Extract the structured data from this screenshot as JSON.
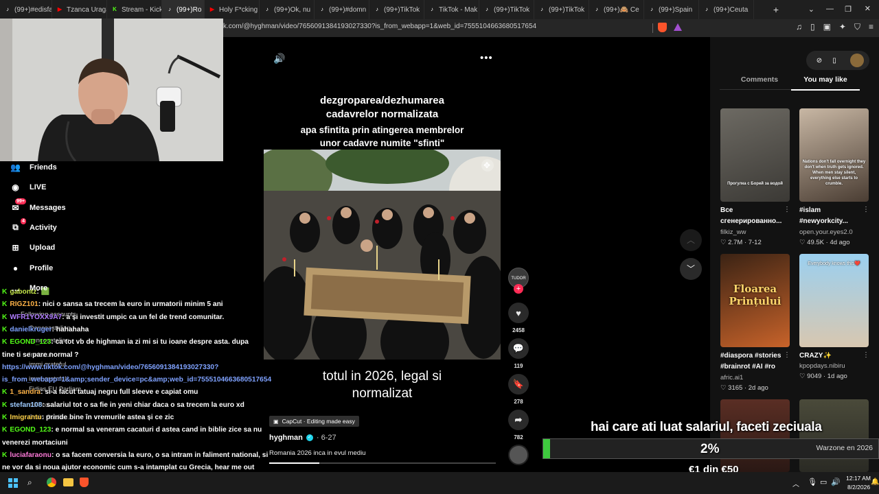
{
  "browser": {
    "tabs": [
      {
        "title": "(99+)#edisfar",
        "favicon": "tiktok",
        "color": "#ffffff"
      },
      {
        "title": "Tzanca Uraga",
        "favicon": "youtube",
        "color": "#ff0000"
      },
      {
        "title": "Stream - Kick",
        "favicon": "kick",
        "color": "#53fc18"
      },
      {
        "title": "(99+)Ro",
        "favicon": "tiktok",
        "color": "#ffffff",
        "active": true
      },
      {
        "title": "Holy F*cking",
        "favicon": "youtube",
        "color": "#ff0000"
      },
      {
        "title": "(99+)Ok, nu",
        "favicon": "tiktok",
        "color": "#ffffff"
      },
      {
        "title": "(99+)#domn",
        "favicon": "tiktok",
        "color": "#ffffff"
      },
      {
        "title": "(99+)TikTok",
        "favicon": "tiktok",
        "color": "#ffffff"
      },
      {
        "title": "TikTok - Mak",
        "favicon": "tiktok",
        "color": "#ffffff"
      },
      {
        "title": "(99+)TikTok",
        "favicon": "tiktok",
        "color": "#ffffff"
      },
      {
        "title": "(99+)TikTok",
        "favicon": "tiktok",
        "color": "#ffffff"
      },
      {
        "title": "(99+)🙈 Ce",
        "favicon": "tiktok",
        "color": "#ffffff"
      },
      {
        "title": "(99+)Spain",
        "favicon": "tiktok",
        "color": "#ffffff"
      },
      {
        "title": "(99+)Ceuta",
        "favicon": "tiktok",
        "color": "#ffffff"
      }
    ],
    "new_tab_label": "+",
    "url": "k.com/@hyghman/video/7656091384193027330?is_from_webapp=1&web_id=7555104663680517654"
  },
  "sidebar": {
    "items": [
      {
        "label": "Friends",
        "icon": "friends-icon"
      },
      {
        "label": "LIVE",
        "icon": "live-icon"
      },
      {
        "label": "Messages",
        "icon": "messages-icon",
        "badge": "99+"
      },
      {
        "label": "Activity",
        "icon": "activity-icon",
        "badge": "4"
      },
      {
        "label": "Upload",
        "icon": "upload-icon"
      },
      {
        "label": "Profile",
        "icon": "profile-icon"
      },
      {
        "label": "More",
        "icon": "more-icon"
      }
    ],
    "following_label": "Following accounts",
    "following": [
      "Oanceastelian",
      "oanceastelian",
      "Invitatul",
      "immi.grateful",
      "immi.grateful",
      "Fidias EU Parliam...",
      "stirivox",
      "Sorin Ovidiu..."
    ]
  },
  "chat": [
    {
      "user": "gabontz",
      "color": "#c6e84b",
      "text": ": 🟩"
    },
    {
      "user": "RIGZ101",
      "color": "#ffb347",
      "text": ": nici o sansa sa trecem la euro in urmatorii minim 5 ani"
    },
    {
      "user": "WFR1YOXX9A7",
      "color": "#b07cff",
      "text": ": a și investit umpic ca un fel de trend comunitar."
    },
    {
      "user": "danielkruger",
      "color": "#7fa2ff",
      "text": ": hahahaha"
    },
    {
      "user": "EGOND_123",
      "color": "#53fc18",
      "text": ": ca tot vb de highman ia zi mi si tu ioane despre asta. dupa"
    },
    {
      "user": "",
      "color": "#ffffff",
      "text": "tine ti se pare normal ?"
    },
    {
      "user": "",
      "color": "#7fa2ff",
      "text": "https://www.tiktok.com/@hyghman/video/7656091384193027330?"
    },
    {
      "user": "",
      "color": "#7fa2ff",
      "text": "is_from_webapp=1&amp;sender_device=pc&amp;web_id=7555104663680517654"
    },
    {
      "user": "1_sandra",
      "color": "#ffb347",
      "text": ": si-a facut tatuaj negru full sleeve e capiat omu"
    },
    {
      "user": "stefan108",
      "color": "#9ecbff",
      "text": ": salariul tot o sa fie in yeni chiar daca o sa trecem la euro xd"
    },
    {
      "user": "Imigrantu",
      "color": "#ffd24a",
      "text": ": prinde bine în vremurile astea și ce zic"
    },
    {
      "user": "EGOND_123",
      "color": "#53fc18",
      "text": ": e normal sa veneram cacaturi d astea cand in biblie zice sa nu"
    },
    {
      "user": "",
      "color": "#ffffff",
      "text": "venerezi mortaciuni"
    },
    {
      "user": "luciafaraonu",
      "color": "#ff7ad9",
      "text": ": o sa facem conversia la euro, o sa intram in faliment national, si"
    },
    {
      "user": "",
      "color": "#ffffff",
      "text": "ne vor da si noua ajutor economic cum s-a intamplat cu Grecia, hear me out"
    },
    {
      "user": "EGOND_123",
      "color": "#53fc18",
      "text": ": ba spune ioane"
    }
  ],
  "video": {
    "caption_top_1": "dezgroparea/dezhumarea",
    "caption_top_2": "cadavrelor normalizata",
    "caption_top_3": "apa sfintita prin atingerea membrelor",
    "caption_top_4": "unor cadavre numite \"sfinti\"",
    "caption_bottom_1": "totul in 2026, legal si",
    "caption_bottom_2": "normalizat",
    "capcut": "CapCut · Editing made easy",
    "author": "hyghman",
    "date": "6-27",
    "description": "Romania 2026 inca in evul mediu",
    "likes": "2458",
    "comments": "119",
    "saves": "278",
    "shares": "782"
  },
  "right_panel": {
    "tab_comments": "Comments",
    "tab_you_may_like": "You may like",
    "cards": [
      {
        "title": "Все",
        "subtitle": "сгенерированно...",
        "author": "filkiz_ww",
        "likes": "2.7M",
        "date": "7-12",
        "thumb_text": "Прогулка с Борей за водой"
      },
      {
        "title": "#islam",
        "subtitle": "#newyorkcity...",
        "author": "open.your.eyes2.0",
        "likes": "49.5K",
        "date": "4d ago",
        "thumb_text": "Nations don't fall overnight they don't when truth gets ignored. When men stay silent, everything else starts to crumble."
      },
      {
        "title": "#diaspora #stories",
        "subtitle": "#brainrot #AI #ro",
        "author": "afric.ai1",
        "likes": "3165",
        "date": "2d ago",
        "thumb_text": "Floarea Prințului"
      },
      {
        "title": "CRAZY✨",
        "subtitle": "",
        "author": "kpopdays.nibiru",
        "likes": "9049",
        "date": "1d ago",
        "thumb_text": "Everybody knows this❤️"
      }
    ]
  },
  "overlay": {
    "donation_title": "hai care ati luat salariul, faceti zeciuala",
    "progress_percent": 2,
    "progress_label": "2%",
    "goal_text": "€1 din €50",
    "side_label": "Warzone en 2026"
  },
  "taskbar": {
    "time": "12:17 AM",
    "date": "8/2/2026"
  },
  "colors": {
    "tiktok_red": "#fe2c55",
    "progress_green": "#3ec93e",
    "kick_green": "#53fc18"
  }
}
